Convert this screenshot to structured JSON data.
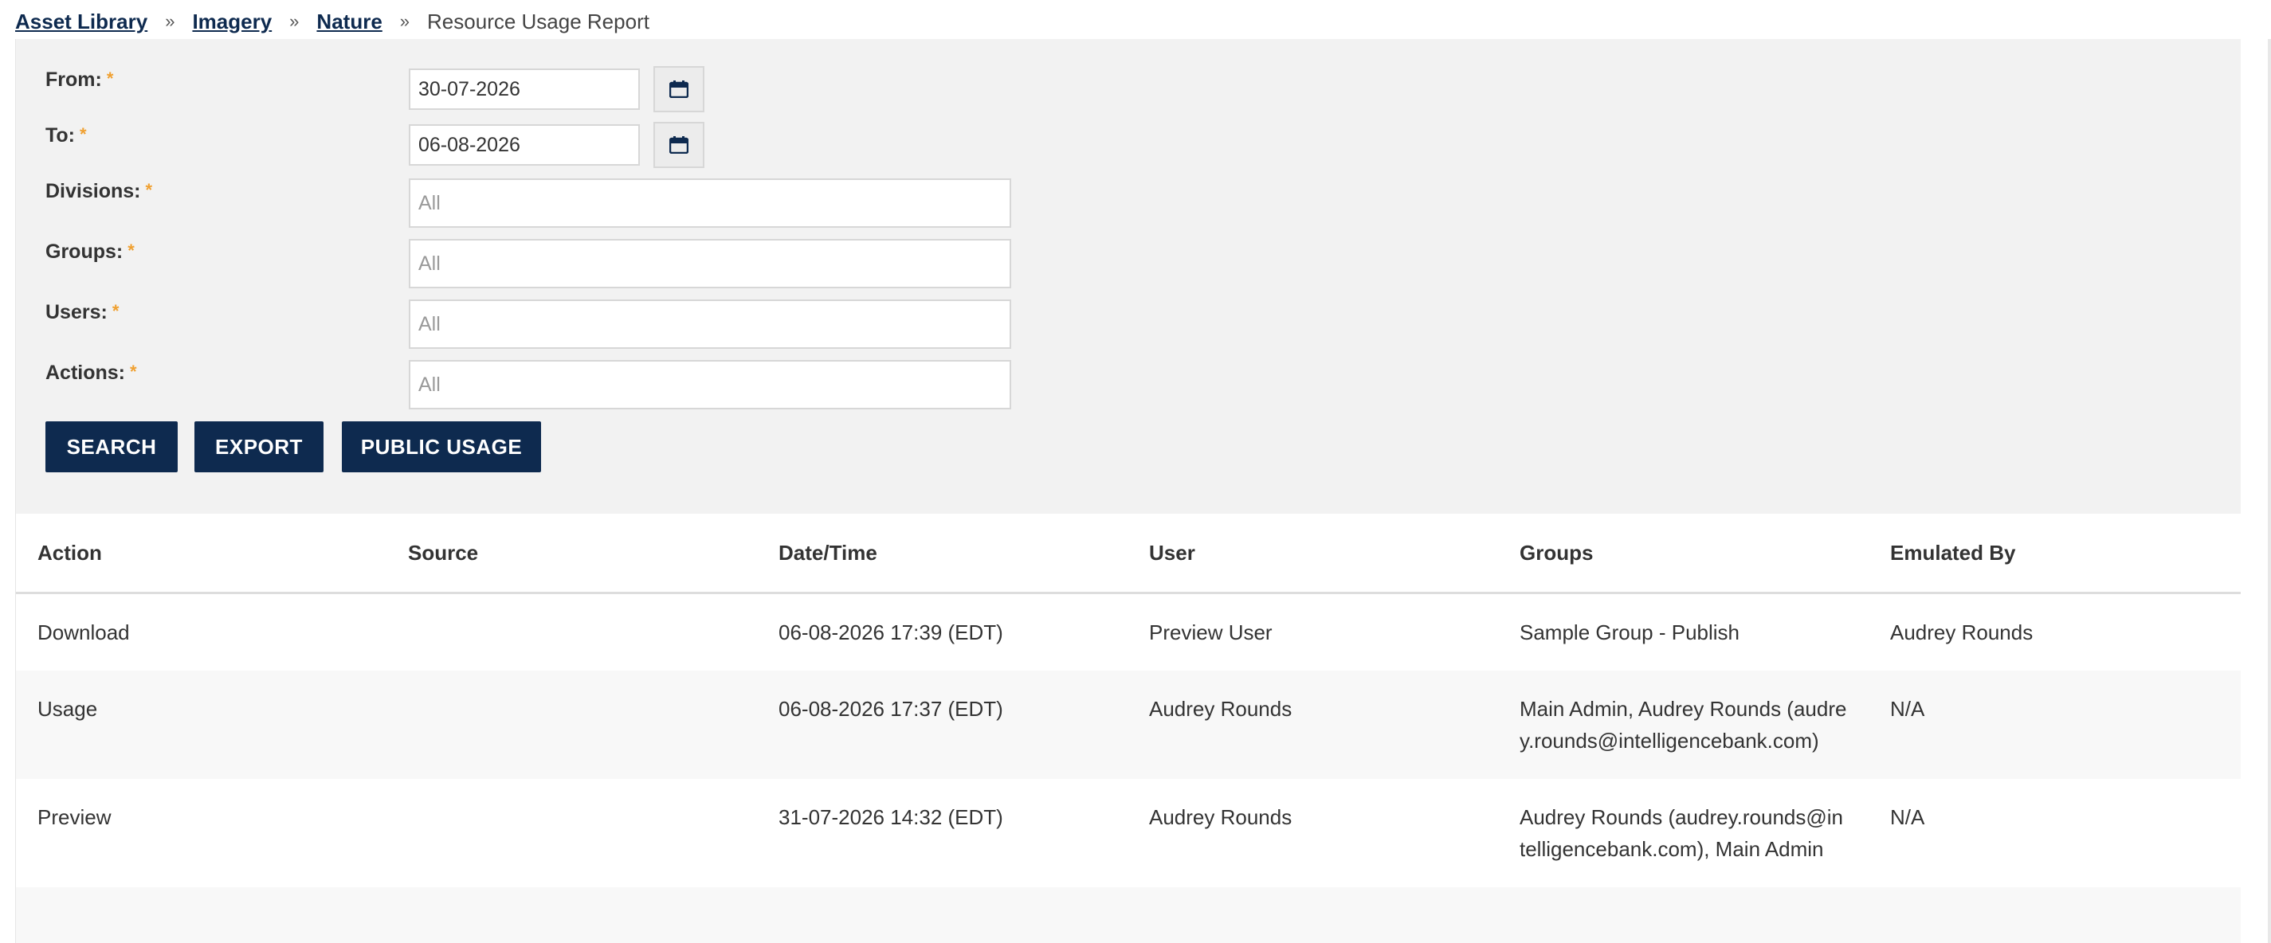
{
  "breadcrumb": {
    "items": [
      "Asset Library",
      "Imagery",
      "Nature"
    ],
    "separator": "»",
    "current": "Resource Usage Report"
  },
  "filters": {
    "from": {
      "label": "From:",
      "value": "30-07-2026"
    },
    "to": {
      "label": "To:",
      "value": "06-08-2026"
    },
    "divisions": {
      "label": "Divisions:",
      "placeholder": "All"
    },
    "groups": {
      "label": "Groups:",
      "placeholder": "All"
    },
    "users": {
      "label": "Users:",
      "placeholder": "All"
    },
    "actions": {
      "label": "Actions:",
      "placeholder": "All"
    },
    "required_marker": "*"
  },
  "buttons": {
    "search": "SEARCH",
    "export": "EXPORT",
    "public_usage": "PUBLIC USAGE"
  },
  "table": {
    "headers": [
      "Action",
      "Source",
      "Date/Time",
      "User",
      "Groups",
      "Emulated By"
    ],
    "rows": [
      [
        "Download",
        "",
        "06-08-2026 17:39 (EDT)",
        "Preview User",
        "Sample Group - Publish",
        "Audrey Rounds"
      ],
      [
        "Usage",
        "",
        "06-08-2026 17:37 (EDT)",
        "Audrey Rounds",
        "Main Admin, Audrey Rounds (audrey.rounds@intelligencebank.com)",
        "N/A"
      ],
      [
        "Preview",
        "",
        "31-07-2026 14:32 (EDT)",
        "Audrey Rounds",
        "Audrey Rounds (audrey.rounds@intelligencebank.com), Main Admin",
        "N/A"
      ]
    ]
  },
  "colors": {
    "primary": "#0e2a4f",
    "required": "#f0a030",
    "panel_bg": "#f2f2f2"
  },
  "icons": {
    "calendar": "calendar-icon"
  }
}
